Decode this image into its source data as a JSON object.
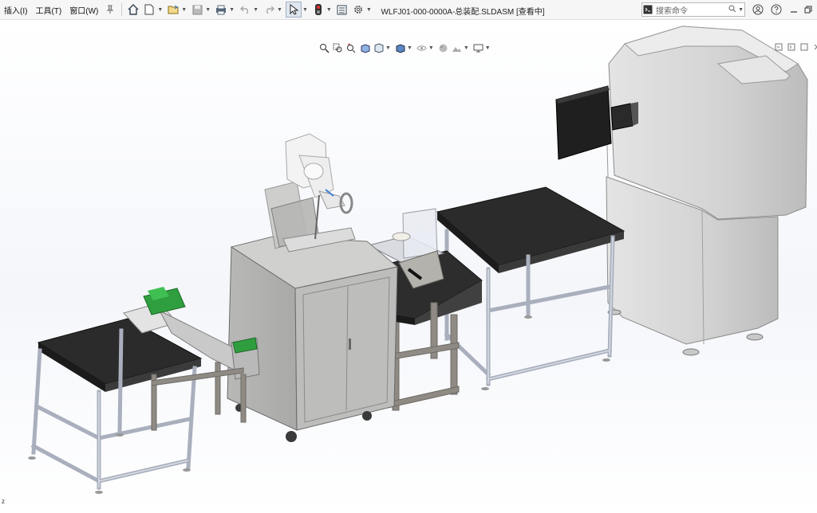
{
  "menu": {
    "items": [
      "插入(I)",
      "工具(T)",
      "窗口(W)"
    ]
  },
  "document": {
    "title": "WLFJ01-000-0000A-总装配.SLDASM [查看中]"
  },
  "search": {
    "placeholder": "搜索命令"
  },
  "axis": {
    "label": "z"
  },
  "colors": {
    "table_top": "#2b2b2b",
    "frame": "#c8ccd6",
    "cabinet": "#c2c2c0",
    "enclosure": "#d6d7d8",
    "monitor": "#222222",
    "green_parts": "#2f9e3f"
  }
}
